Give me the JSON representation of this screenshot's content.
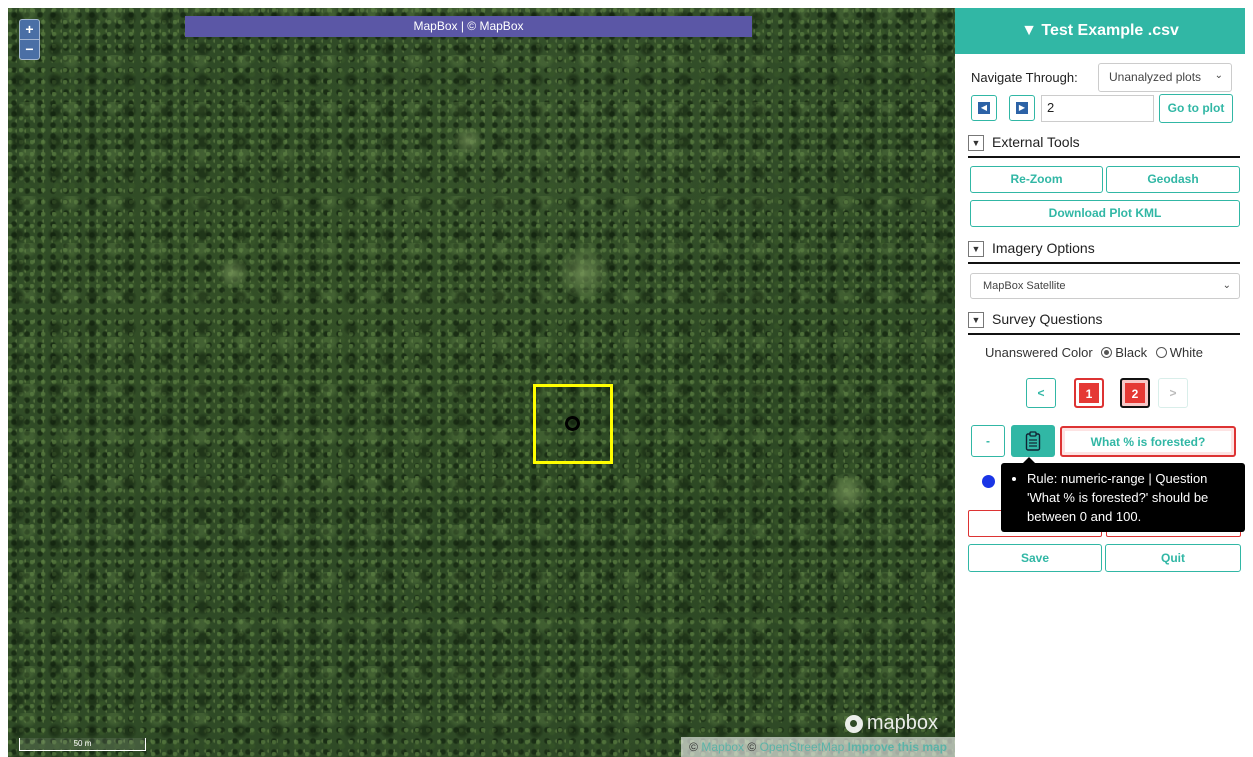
{
  "map": {
    "zoom_in_label": "+",
    "zoom_out_label": "−",
    "banner": "MapBox | © MapBox",
    "scale_label": "50 m",
    "logo_text": "mapbox",
    "attribution": {
      "copy1": "©",
      "mapbox_link": "Mapbox",
      "copy2": "©",
      "osm_link": "OpenStreetMap",
      "improve_link": "Improve this map"
    },
    "plot_color": "#ffff00"
  },
  "sidebar": {
    "title": "▼ Test Example .csv",
    "accent_color": "#31b7a5",
    "navigate": {
      "label": "Navigate Through:",
      "selected": "Unanalyzed plots",
      "plot_number": "2",
      "goto_label": "Go to plot"
    },
    "external_tools": {
      "caret": "▼",
      "title": "External Tools",
      "rezoom_label": "Re-Zoom",
      "geodash_label": "Geodash",
      "kml_label": "Download Plot KML"
    },
    "imagery": {
      "caret": "▼",
      "title": "Imagery Options",
      "selected": "MapBox Satellite"
    },
    "survey": {
      "caret": "▼",
      "title": "Survey Questions",
      "color_label": "Unanswered Color",
      "black_label": "Black",
      "white_label": "White",
      "pages": {
        "prev": "<",
        "p1": "1",
        "p2": "2",
        "next": ">"
      },
      "minus_label": "-",
      "question_label": "What % is forested?",
      "tooltip": "Rule: numeric-range | Question 'What % is forested?' should be between 0 and 100.",
      "save_label": "Save",
      "quit_label": "Quit"
    }
  }
}
